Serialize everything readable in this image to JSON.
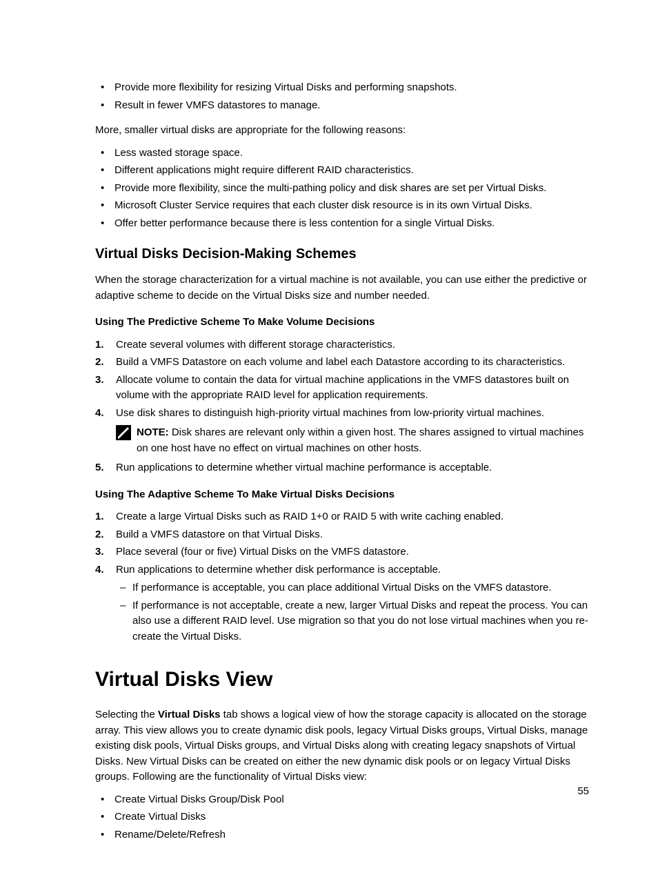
{
  "top_bullets_a": [
    "Provide more flexibility for resizing Virtual Disks and performing snapshots.",
    "Result in fewer VMFS datastores to manage."
  ],
  "para_more_smaller": "More, smaller virtual disks are appropriate for the following reasons:",
  "top_bullets_b": [
    "Less wasted storage space.",
    "Different applications might require different RAID characteristics.",
    "Provide more flexibility, since the multi-pathing policy and disk shares are set per Virtual Disks.",
    "Microsoft Cluster Service requires that each cluster disk resource is in its own Virtual Disks.",
    "Offer better performance because there is less contention for a single Virtual Disks."
  ],
  "h2_schemes": "Virtual Disks Decision-Making Schemes",
  "para_schemes": "When the storage characterization for a virtual machine is not available, you can use either the predictive or adaptive scheme to decide on the Virtual Disks size and number needed.",
  "h3_predictive": "Using The Predictive Scheme To Make Volume Decisions",
  "predictive_steps": [
    "Create several volumes with different storage characteristics.",
    "Build a VMFS Datastore on each volume and label each Datastore according to its characteristics.",
    "Allocate volume to contain the data for virtual machine applications in the VMFS datastores built on volume with the appropriate RAID level for application requirements.",
    "Use disk shares to distinguish high-priority virtual machines from low-priority virtual machines.",
    "Run applications to determine whether virtual machine performance is acceptable."
  ],
  "note_label": "NOTE:",
  "note_text": " Disk shares are relevant only within a given host. The shares assigned to virtual machines on one host have no effect on virtual machines on other hosts.",
  "h3_adaptive": "Using The Adaptive Scheme To Make Virtual Disks Decisions",
  "adaptive_steps": [
    "Create a large Virtual Disks such as RAID 1+0 or RAID 5 with write caching enabled.",
    "Build a VMFS datastore on that Virtual Disks.",
    "Place several (four or five) Virtual Disks on the VMFS datastore.",
    "Run applications to determine whether disk performance is acceptable."
  ],
  "adaptive_sub": [
    "If performance is acceptable, you can place additional Virtual Disks on the VMFS datastore.",
    "If performance is not acceptable, create a new, larger Virtual Disks and repeat the process. You can also use a different RAID level. Use migration so that you do not lose virtual machines when you re-create the Virtual Disks."
  ],
  "h1_view": "Virtual Disks View",
  "view_para_pre": "Selecting the ",
  "view_para_bold": "Virtual Disks",
  "view_para_post": " tab shows a logical view of how the storage capacity is allocated on the storage array. This view allows you to create dynamic disk pools, legacy Virtual Disks groups, Virtual Disks, manage existing disk pools, Virtual Disks groups, and Virtual Disks along with creating legacy snapshots of Virtual Disks. New Virtual Disks can be created on either the new dynamic disk pools or on legacy Virtual Disks groups. Following are the functionality of Virtual Disks view:",
  "view_bullets": [
    "Create Virtual Disks Group/Disk Pool",
    "Create Virtual Disks",
    "Rename/Delete/Refresh"
  ],
  "page_number": "55"
}
